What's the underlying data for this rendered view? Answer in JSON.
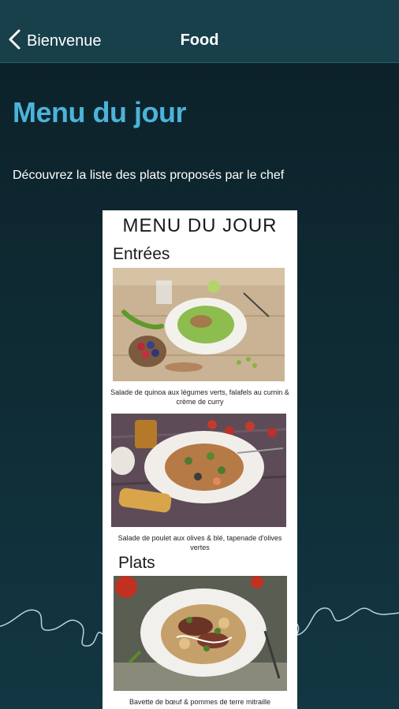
{
  "nav": {
    "back_label": "Bienvenue",
    "title": "Food"
  },
  "page": {
    "heading": "Menu du jour",
    "subtitle": "Découvrez la liste des plats proposés par le chef"
  },
  "menu_image": {
    "title": "MENU DU JOUR",
    "sections": [
      {
        "heading": "Entrées",
        "dishes": [
          {
            "caption": "Salade de quinoa aux légumes verts, falafels au cumin & crème de curry"
          },
          {
            "caption": "Salade de poulet aux olives & blé, tapenade d'olives vertes"
          }
        ]
      },
      {
        "heading": "Plats",
        "dishes": [
          {
            "caption": "Bavette de bœuf & pommes de terre mitraille"
          }
        ]
      }
    ]
  },
  "colors": {
    "heading_accent": "#4cb3d9",
    "navbar": "#17404a",
    "background": "#0f2c35"
  },
  "icons": {
    "back": "chevron-left-icon"
  }
}
